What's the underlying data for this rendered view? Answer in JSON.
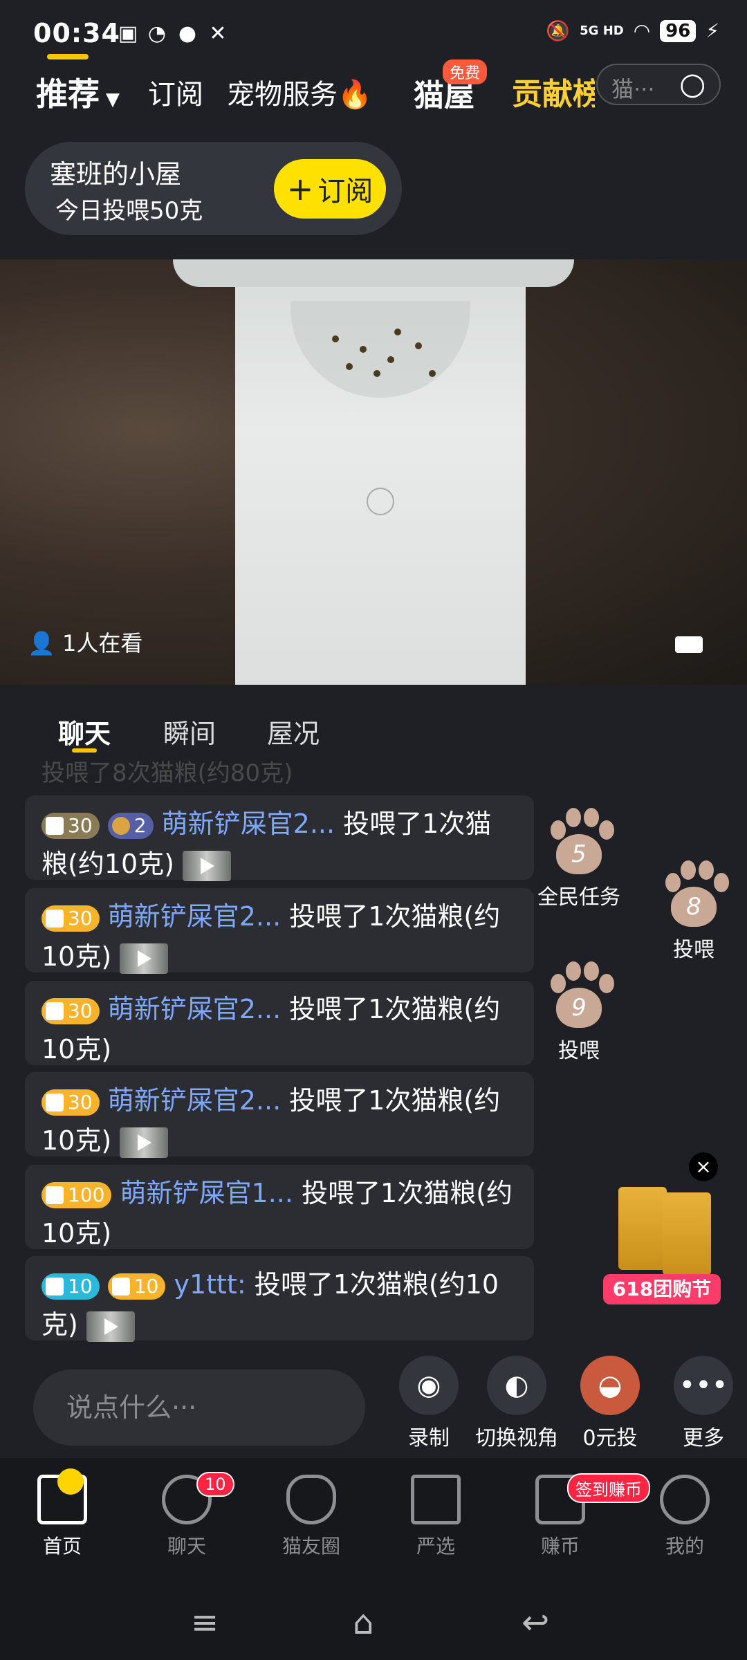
{
  "status_bar": {
    "time": "00:34",
    "network": "5G HD",
    "battery": "96"
  },
  "top_tabs": {
    "items": [
      "推荐",
      "订阅",
      "宠物服务🔥",
      "猫屋",
      "贡献榜"
    ],
    "free_badge": "免费",
    "search_placeholder": "猫···"
  },
  "room": {
    "name": "塞班的小屋",
    "today_feed": "今日投喂50克",
    "subscribe_label": "订阅"
  },
  "video": {
    "viewers": "1人在看"
  },
  "chat_tabs": [
    "聊天",
    "瞬间",
    "屋况"
  ],
  "chat": {
    "faded_line": "投喂了8次猫粮(约80克)",
    "messages": [
      {
        "badges": [
          {
            "value": "30",
            "style": "dull"
          },
          {
            "value": "2",
            "style": "purple"
          }
        ],
        "user": "萌新铲屎官2...",
        "text": " 投喂了1次猫粮(约10克)",
        "thumb": true
      },
      {
        "badges": [
          {
            "value": "30",
            "style": "orange"
          }
        ],
        "user": "萌新铲屎官2...",
        "text": " 投喂了1次猫粮(约10克)",
        "thumb": true
      },
      {
        "badges": [
          {
            "value": "30",
            "style": "orange"
          }
        ],
        "user": "萌新铲屎官2...",
        "text": " 投喂了1次猫粮(约10克)",
        "thumb": false
      },
      {
        "badges": [
          {
            "value": "30",
            "style": "orange"
          }
        ],
        "user": "萌新铲屎官2...",
        "text": " 投喂了1次猫粮(约10克)",
        "thumb": true
      },
      {
        "badges": [
          {
            "value": "100",
            "style": "orange"
          }
        ],
        "user": "萌新铲屎官1...",
        "text": " 投喂了1次猫粮(约10克)",
        "thumb": false
      },
      {
        "badges": [
          {
            "value": "10",
            "style": "cyan"
          },
          {
            "value": "10",
            "style": "orange"
          }
        ],
        "user": "y1ttt:",
        "text": " 投喂了1次猫粮(约10克)",
        "thumb": true
      }
    ]
  },
  "paws": [
    {
      "count": "5",
      "label": "全民任务"
    },
    {
      "count": "8",
      "label": "投喂"
    },
    {
      "count": "9",
      "label": "投喂"
    }
  ],
  "promo": {
    "label": "618团购节",
    "close": "×"
  },
  "input": {
    "placeholder": "说点什么···"
  },
  "actions": [
    {
      "label": "录制",
      "icon": "record-icon"
    },
    {
      "label": "切换视角",
      "icon": "switch-view-icon"
    },
    {
      "label": "0元投",
      "icon": "free-feed-icon"
    },
    {
      "label": "更多",
      "icon": "more-icon"
    }
  ],
  "bottom_nav": {
    "items": [
      {
        "label": "首页",
        "icon": "home-icon"
      },
      {
        "label": "聊天",
        "icon": "chat-icon"
      },
      {
        "label": "猫友圈",
        "icon": "cat-circle-icon"
      },
      {
        "label": "严选",
        "icon": "store-icon"
      },
      {
        "label": "赚币",
        "icon": "earn-coins-icon"
      },
      {
        "label": "我的",
        "icon": "profile-icon"
      }
    ],
    "chat_badge": "10",
    "earn_badge": "签到赚币"
  }
}
